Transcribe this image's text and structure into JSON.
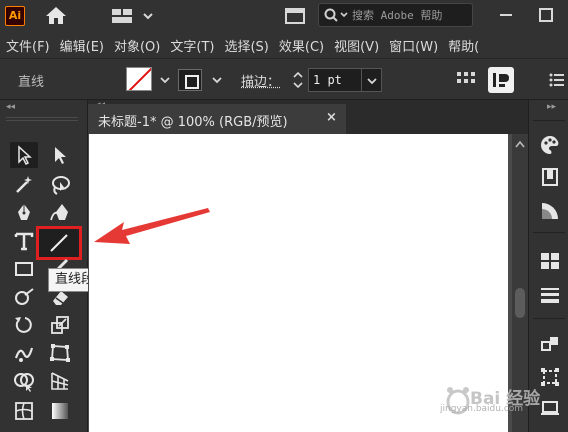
{
  "appbar": {
    "logo": "Ai",
    "search_placeholder": "搜索 Adobe 帮助",
    "icons": [
      "home-icon",
      "workspace-switcher-icon",
      "arrange-documents-icon",
      "search-icon",
      "minimize-icon",
      "maximize-icon"
    ]
  },
  "menubar": {
    "items": [
      "文件(F)",
      "编辑(E)",
      "对象(O)",
      "文字(T)",
      "选择(S)",
      "效果(C)",
      "视图(V)",
      "窗口(W)",
      "帮助("
    ]
  },
  "controlbar": {
    "object_label": "直线",
    "stroke_label": "描边：",
    "stroke_weight": "1 pt",
    "stroke_color": "#e01010"
  },
  "document": {
    "tab_title": "未标题-1* @ 100% (RGB/预览)",
    "close_glyph": "×"
  },
  "tooltip": {
    "text": "直线段工具 (\\)"
  },
  "toolpanel": {
    "collapse_glyph": "◂◂",
    "tools": [
      "selection-tool",
      "direct-selection-tool",
      "magic-wand-tool",
      "lasso-tool",
      "pen-tool",
      "curvature-tool",
      "type-tool",
      "line-segment-tool",
      "rectangle-tool",
      "paintbrush-tool",
      "shaper-tool",
      "eraser-tool",
      "rotate-tool",
      "scale-tool",
      "warp-tool",
      "free-transform-tool",
      "shape-builder-tool",
      "perspective-grid-tool",
      "mesh-tool",
      "gradient-tool"
    ]
  },
  "rightdock": {
    "panels": [
      "color-panel",
      "libraries-panel",
      "color-guide-panel",
      "swatches-panel",
      "stroke-panel",
      "align-panel",
      "transform-panel",
      "layers-panel"
    ]
  },
  "watermark": {
    "brand": "Bai 经验",
    "url": "jingyan.baidu.com"
  },
  "colors": {
    "ui_dark": "#323232",
    "canvas_bg": "#2b2b2b",
    "highlight_red": "#e02020",
    "artboard": "#ffffff"
  }
}
